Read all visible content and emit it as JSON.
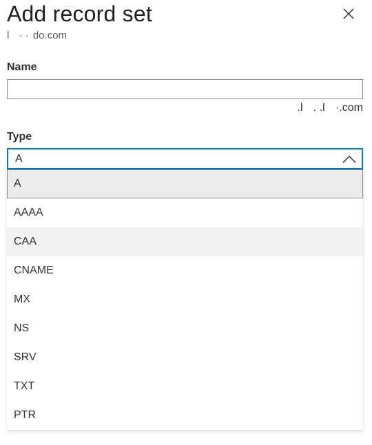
{
  "panel": {
    "title": "Add record set",
    "subtitle": "l    ·  ·  do.com",
    "close_icon": "close-icon"
  },
  "form": {
    "name": {
      "label": "Name",
      "value": "",
      "placeholder": "",
      "suffix": ".l     . .l    ·.com"
    },
    "type": {
      "label": "Type",
      "selected": "A",
      "expanded": true,
      "chevron_icon": "chevron-up-icon",
      "options": [
        {
          "label": "A",
          "state": "selected"
        },
        {
          "label": "AAAA",
          "state": "normal"
        },
        {
          "label": "CAA",
          "state": "hovered"
        },
        {
          "label": "CNAME",
          "state": "normal"
        },
        {
          "label": "MX",
          "state": "normal"
        },
        {
          "label": "NS",
          "state": "normal"
        },
        {
          "label": "SRV",
          "state": "normal"
        },
        {
          "label": "TXT",
          "state": "normal"
        },
        {
          "label": "PTR",
          "state": "normal"
        }
      ]
    }
  },
  "colors": {
    "focus_border": "#0078d4",
    "selected_bg": "#edebe9",
    "hover_bg": "#f3f2f1"
  }
}
